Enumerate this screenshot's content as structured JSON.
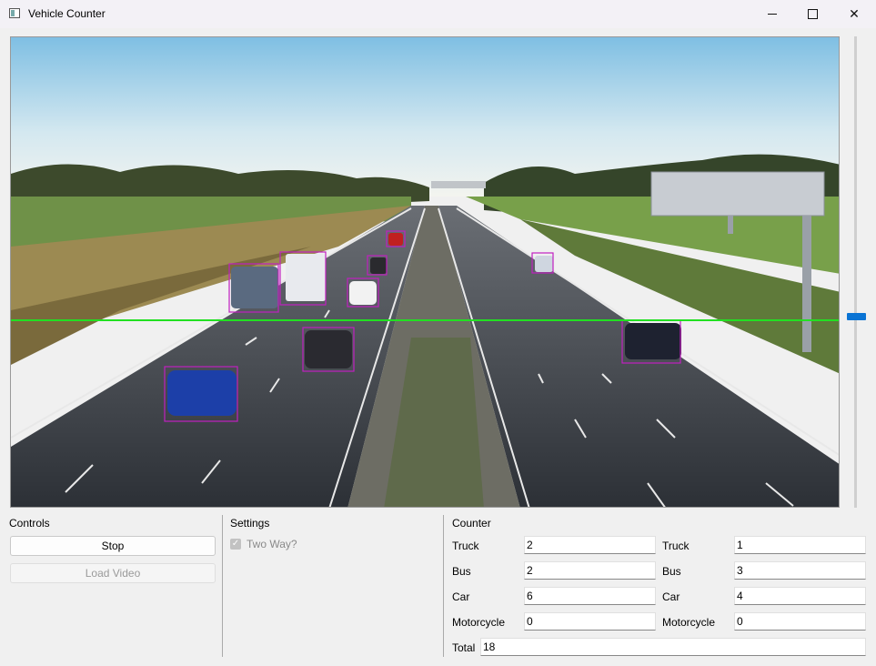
{
  "window": {
    "title": "Vehicle Counter"
  },
  "controls": {
    "title": "Controls",
    "stop_label": "Stop",
    "load_label": "Load Video"
  },
  "settings": {
    "title": "Settings",
    "two_way_label": "Two Way?",
    "two_way_checked": true
  },
  "counter": {
    "title": "Counter",
    "rows": [
      {
        "label_a": "Truck",
        "value_a": "2",
        "label_b": "Truck",
        "value_b": "1"
      },
      {
        "label_a": "Bus",
        "value_a": "2",
        "label_b": "Bus",
        "value_b": "3"
      },
      {
        "label_a": "Car",
        "value_a": "6",
        "label_b": "Car",
        "value_b": "4"
      },
      {
        "label_a": "Motorcycle",
        "value_a": "0",
        "label_b": "Motorcycle",
        "value_b": "0"
      }
    ],
    "total_label": "Total",
    "total_value": "18"
  },
  "colors": {
    "detection_box": "#c020c0",
    "counting_line": "#22e022",
    "slider_handle": "#0a74d4"
  }
}
